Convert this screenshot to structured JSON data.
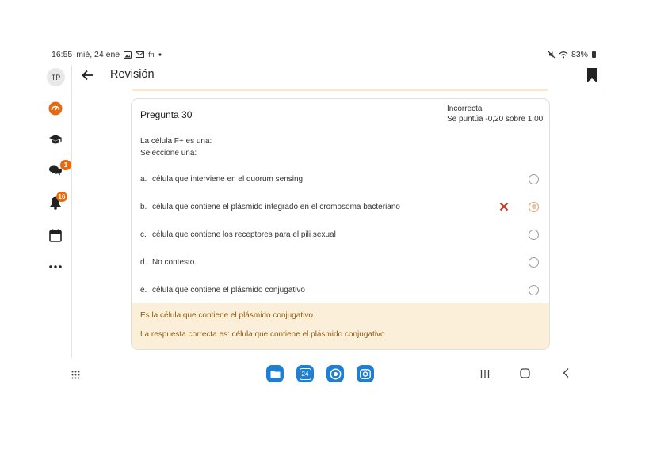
{
  "status_bar": {
    "time": "16:55",
    "date": "mié, 24 ene",
    "notification_icons": [
      "image-icon",
      "gmail-icon",
      "fn-icon",
      "dot-icon"
    ],
    "fn_glyph": "fn",
    "battery": "83%"
  },
  "sidebar": {
    "avatar_initials": "TP",
    "messages_badge": "1",
    "notifications_badge": "16"
  },
  "header": {
    "title": "Revisión"
  },
  "question": {
    "title": "Pregunta 30",
    "state": "Incorrecta",
    "grade": "Se puntúa -0,20 sobre 1,00",
    "text": "La célula F+ es una:",
    "prompt": "Seleccione una:",
    "options": [
      {
        "letter": "a.",
        "text": "célula que interviene en el quorum sensing",
        "selected": false
      },
      {
        "letter": "b.",
        "text": "célula que contiene el plásmido integrado en el cromosoma bacteriano",
        "selected": true,
        "incorrect": true
      },
      {
        "letter": "c.",
        "text": "célula que contiene los receptores para el pili sexual",
        "selected": false
      },
      {
        "letter": "d.",
        "text": "No contesto.",
        "selected": false
      },
      {
        "letter": "e.",
        "text": "célula que contiene el plásmido conjugativo",
        "selected": false
      }
    ],
    "general_feedback": "Es la célula que contiene el plásmido conjugativo",
    "right_answer": "La respuesta correcta es: célula que contiene el plásmido conjugativo"
  },
  "dock": {
    "calendar_day": "24"
  },
  "colors": {
    "accent_orange": "#e66b10",
    "feedback_bg": "#fcefd9",
    "feedback_text": "#8a5a12",
    "incorrect_red": "#c0392b",
    "dock_blue": "#1e7fd6"
  }
}
